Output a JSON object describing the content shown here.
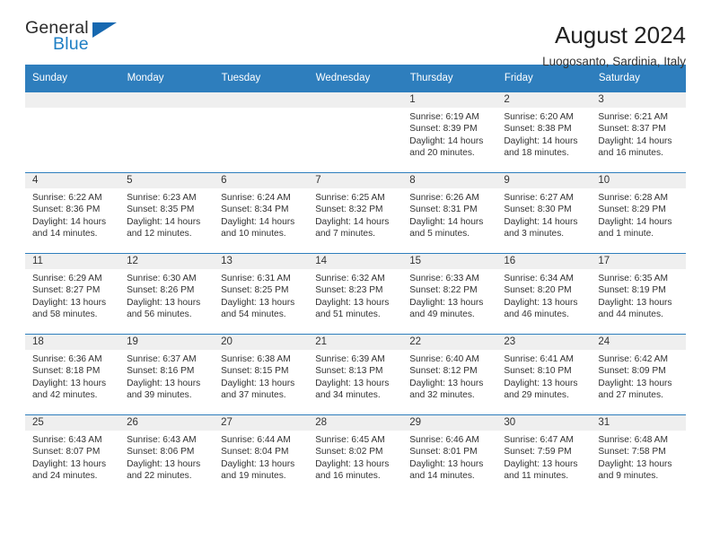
{
  "brand": {
    "name_top": "General",
    "name_bottom": "Blue",
    "accent_color": "#1668b0",
    "text_color": "#2b2b2b"
  },
  "header": {
    "title": "August 2024",
    "subtitle": "Luogosanto, Sardinia, Italy"
  },
  "theme": {
    "header_bg": "#2e7ebd",
    "header_text": "#ffffff",
    "daynum_band_bg": "#efefef",
    "cell_bg": "#ffffff",
    "body_text": "#333333"
  },
  "calendar": {
    "weekday_headers": [
      "Sunday",
      "Monday",
      "Tuesday",
      "Wednesday",
      "Thursday",
      "Friday",
      "Saturday"
    ],
    "labels": {
      "sunrise": "Sunrise:",
      "sunset": "Sunset:",
      "daylight": "Daylight:"
    },
    "weeks": [
      [
        {
          "day": "",
          "sunrise": "",
          "sunset": "",
          "daylight_line1": "",
          "daylight_line2": "",
          "empty": true
        },
        {
          "day": "",
          "sunrise": "",
          "sunset": "",
          "daylight_line1": "",
          "daylight_line2": "",
          "empty": true
        },
        {
          "day": "",
          "sunrise": "",
          "sunset": "",
          "daylight_line1": "",
          "daylight_line2": "",
          "empty": true
        },
        {
          "day": "",
          "sunrise": "",
          "sunset": "",
          "daylight_line1": "",
          "daylight_line2": "",
          "empty": true
        },
        {
          "day": "1",
          "sunrise": "Sunrise: 6:19 AM",
          "sunset": "Sunset: 8:39 PM",
          "daylight_line1": "Daylight: 14 hours",
          "daylight_line2": "and 20 minutes."
        },
        {
          "day": "2",
          "sunrise": "Sunrise: 6:20 AM",
          "sunset": "Sunset: 8:38 PM",
          "daylight_line1": "Daylight: 14 hours",
          "daylight_line2": "and 18 minutes."
        },
        {
          "day": "3",
          "sunrise": "Sunrise: 6:21 AM",
          "sunset": "Sunset: 8:37 PM",
          "daylight_line1": "Daylight: 14 hours",
          "daylight_line2": "and 16 minutes."
        }
      ],
      [
        {
          "day": "4",
          "sunrise": "Sunrise: 6:22 AM",
          "sunset": "Sunset: 8:36 PM",
          "daylight_line1": "Daylight: 14 hours",
          "daylight_line2": "and 14 minutes."
        },
        {
          "day": "5",
          "sunrise": "Sunrise: 6:23 AM",
          "sunset": "Sunset: 8:35 PM",
          "daylight_line1": "Daylight: 14 hours",
          "daylight_line2": "and 12 minutes."
        },
        {
          "day": "6",
          "sunrise": "Sunrise: 6:24 AM",
          "sunset": "Sunset: 8:34 PM",
          "daylight_line1": "Daylight: 14 hours",
          "daylight_line2": "and 10 minutes."
        },
        {
          "day": "7",
          "sunrise": "Sunrise: 6:25 AM",
          "sunset": "Sunset: 8:32 PM",
          "daylight_line1": "Daylight: 14 hours",
          "daylight_line2": "and 7 minutes."
        },
        {
          "day": "8",
          "sunrise": "Sunrise: 6:26 AM",
          "sunset": "Sunset: 8:31 PM",
          "daylight_line1": "Daylight: 14 hours",
          "daylight_line2": "and 5 minutes."
        },
        {
          "day": "9",
          "sunrise": "Sunrise: 6:27 AM",
          "sunset": "Sunset: 8:30 PM",
          "daylight_line1": "Daylight: 14 hours",
          "daylight_line2": "and 3 minutes."
        },
        {
          "day": "10",
          "sunrise": "Sunrise: 6:28 AM",
          "sunset": "Sunset: 8:29 PM",
          "daylight_line1": "Daylight: 14 hours",
          "daylight_line2": "and 1 minute."
        }
      ],
      [
        {
          "day": "11",
          "sunrise": "Sunrise: 6:29 AM",
          "sunset": "Sunset: 8:27 PM",
          "daylight_line1": "Daylight: 13 hours",
          "daylight_line2": "and 58 minutes."
        },
        {
          "day": "12",
          "sunrise": "Sunrise: 6:30 AM",
          "sunset": "Sunset: 8:26 PM",
          "daylight_line1": "Daylight: 13 hours",
          "daylight_line2": "and 56 minutes."
        },
        {
          "day": "13",
          "sunrise": "Sunrise: 6:31 AM",
          "sunset": "Sunset: 8:25 PM",
          "daylight_line1": "Daylight: 13 hours",
          "daylight_line2": "and 54 minutes."
        },
        {
          "day": "14",
          "sunrise": "Sunrise: 6:32 AM",
          "sunset": "Sunset: 8:23 PM",
          "daylight_line1": "Daylight: 13 hours",
          "daylight_line2": "and 51 minutes."
        },
        {
          "day": "15",
          "sunrise": "Sunrise: 6:33 AM",
          "sunset": "Sunset: 8:22 PM",
          "daylight_line1": "Daylight: 13 hours",
          "daylight_line2": "and 49 minutes."
        },
        {
          "day": "16",
          "sunrise": "Sunrise: 6:34 AM",
          "sunset": "Sunset: 8:20 PM",
          "daylight_line1": "Daylight: 13 hours",
          "daylight_line2": "and 46 minutes."
        },
        {
          "day": "17",
          "sunrise": "Sunrise: 6:35 AM",
          "sunset": "Sunset: 8:19 PM",
          "daylight_line1": "Daylight: 13 hours",
          "daylight_line2": "and 44 minutes."
        }
      ],
      [
        {
          "day": "18",
          "sunrise": "Sunrise: 6:36 AM",
          "sunset": "Sunset: 8:18 PM",
          "daylight_line1": "Daylight: 13 hours",
          "daylight_line2": "and 42 minutes."
        },
        {
          "day": "19",
          "sunrise": "Sunrise: 6:37 AM",
          "sunset": "Sunset: 8:16 PM",
          "daylight_line1": "Daylight: 13 hours",
          "daylight_line2": "and 39 minutes."
        },
        {
          "day": "20",
          "sunrise": "Sunrise: 6:38 AM",
          "sunset": "Sunset: 8:15 PM",
          "daylight_line1": "Daylight: 13 hours",
          "daylight_line2": "and 37 minutes."
        },
        {
          "day": "21",
          "sunrise": "Sunrise: 6:39 AM",
          "sunset": "Sunset: 8:13 PM",
          "daylight_line1": "Daylight: 13 hours",
          "daylight_line2": "and 34 minutes."
        },
        {
          "day": "22",
          "sunrise": "Sunrise: 6:40 AM",
          "sunset": "Sunset: 8:12 PM",
          "daylight_line1": "Daylight: 13 hours",
          "daylight_line2": "and 32 minutes."
        },
        {
          "day": "23",
          "sunrise": "Sunrise: 6:41 AM",
          "sunset": "Sunset: 8:10 PM",
          "daylight_line1": "Daylight: 13 hours",
          "daylight_line2": "and 29 minutes."
        },
        {
          "day": "24",
          "sunrise": "Sunrise: 6:42 AM",
          "sunset": "Sunset: 8:09 PM",
          "daylight_line1": "Daylight: 13 hours",
          "daylight_line2": "and 27 minutes."
        }
      ],
      [
        {
          "day": "25",
          "sunrise": "Sunrise: 6:43 AM",
          "sunset": "Sunset: 8:07 PM",
          "daylight_line1": "Daylight: 13 hours",
          "daylight_line2": "and 24 minutes."
        },
        {
          "day": "26",
          "sunrise": "Sunrise: 6:43 AM",
          "sunset": "Sunset: 8:06 PM",
          "daylight_line1": "Daylight: 13 hours",
          "daylight_line2": "and 22 minutes."
        },
        {
          "day": "27",
          "sunrise": "Sunrise: 6:44 AM",
          "sunset": "Sunset: 8:04 PM",
          "daylight_line1": "Daylight: 13 hours",
          "daylight_line2": "and 19 minutes."
        },
        {
          "day": "28",
          "sunrise": "Sunrise: 6:45 AM",
          "sunset": "Sunset: 8:02 PM",
          "daylight_line1": "Daylight: 13 hours",
          "daylight_line2": "and 16 minutes."
        },
        {
          "day": "29",
          "sunrise": "Sunrise: 6:46 AM",
          "sunset": "Sunset: 8:01 PM",
          "daylight_line1": "Daylight: 13 hours",
          "daylight_line2": "and 14 minutes."
        },
        {
          "day": "30",
          "sunrise": "Sunrise: 6:47 AM",
          "sunset": "Sunset: 7:59 PM",
          "daylight_line1": "Daylight: 13 hours",
          "daylight_line2": "and 11 minutes."
        },
        {
          "day": "31",
          "sunrise": "Sunrise: 6:48 AM",
          "sunset": "Sunset: 7:58 PM",
          "daylight_line1": "Daylight: 13 hours",
          "daylight_line2": "and 9 minutes."
        }
      ]
    ]
  }
}
